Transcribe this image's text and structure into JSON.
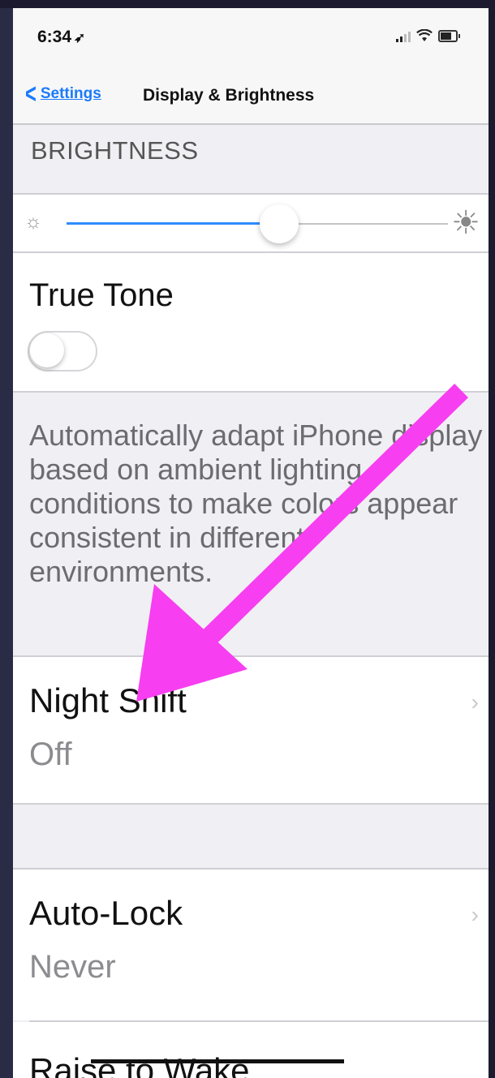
{
  "status_bar": {
    "time": "6:34",
    "location_glyph": "➶"
  },
  "nav": {
    "back_label": "Settings",
    "title": "Display & Brightness"
  },
  "brightness": {
    "section_header": "BRIGHTNESS",
    "level": 0.53
  },
  "true_tone": {
    "label": "True Tone",
    "enabled": false,
    "description": "Automatically adapt iPhone display based on ambient lighting conditions to make colors appear consistent in different environments."
  },
  "night_shift": {
    "label": "Night Shift",
    "value": "Off"
  },
  "auto_lock": {
    "label": "Auto-Lock",
    "value": "Never"
  },
  "raise_to_wake": {
    "label": "Raise to Wake"
  },
  "annotation": {
    "arrow_color": "#f73ef0"
  },
  "colors": {
    "accent": "#1a7bfb",
    "background": "#f0eff4"
  }
}
